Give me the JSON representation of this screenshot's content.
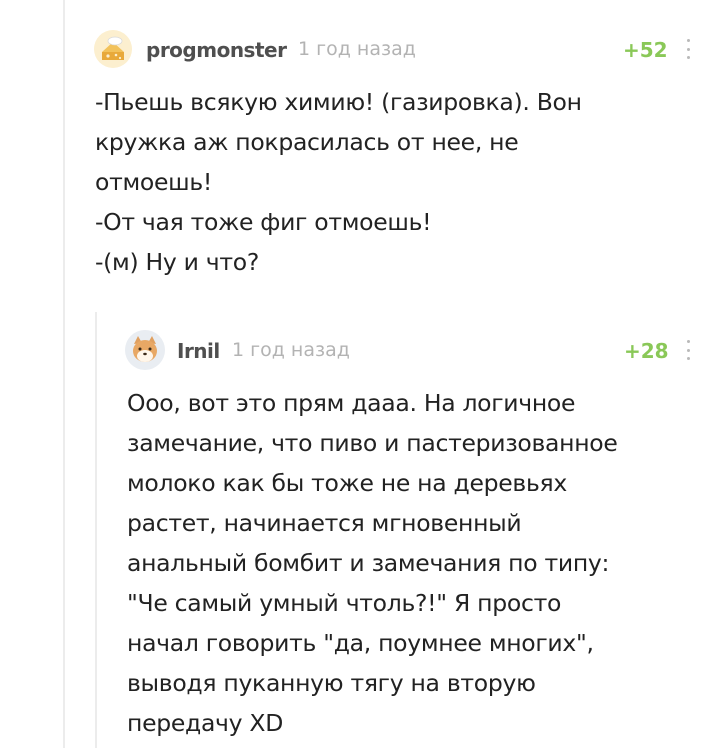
{
  "comments": [
    {
      "author": "progmonster",
      "time": "1 год назад",
      "rating": "+52",
      "avatar_icon": "bread-cheese-avatar-icon",
      "lines": [
        "-Пьешь всякую химию! (газировка). Вон",
        "кружка аж покрасилась от нее, не",
        "отмоешь!",
        "-От чая тоже фиг отмоешь!",
        "-(м) Ну и что?"
      ]
    },
    {
      "author": "Irnil",
      "time": "1 год назад",
      "rating": "+28",
      "avatar_icon": "shiba-dog-avatar-icon",
      "lines": [
        "Ооо, вот это прям дааа. На логичное",
        "замечание, что пиво и пастеризованное",
        "молоко как бы тоже не на деревьях",
        "растет, начинается мгновенный",
        "анальный бомбит и замечания по типу:",
        "\"Че самый умный чтоль?!\" Я просто",
        "начал говорить \"да, поумнее многих\",",
        "выводя пуканную тягу на вторую",
        "передачу XD"
      ]
    }
  ],
  "colors": {
    "rating_positive": "#8ac858",
    "username": "#4f4f4f",
    "meta": "#b3b3b3",
    "thread_line": "#ececec"
  }
}
